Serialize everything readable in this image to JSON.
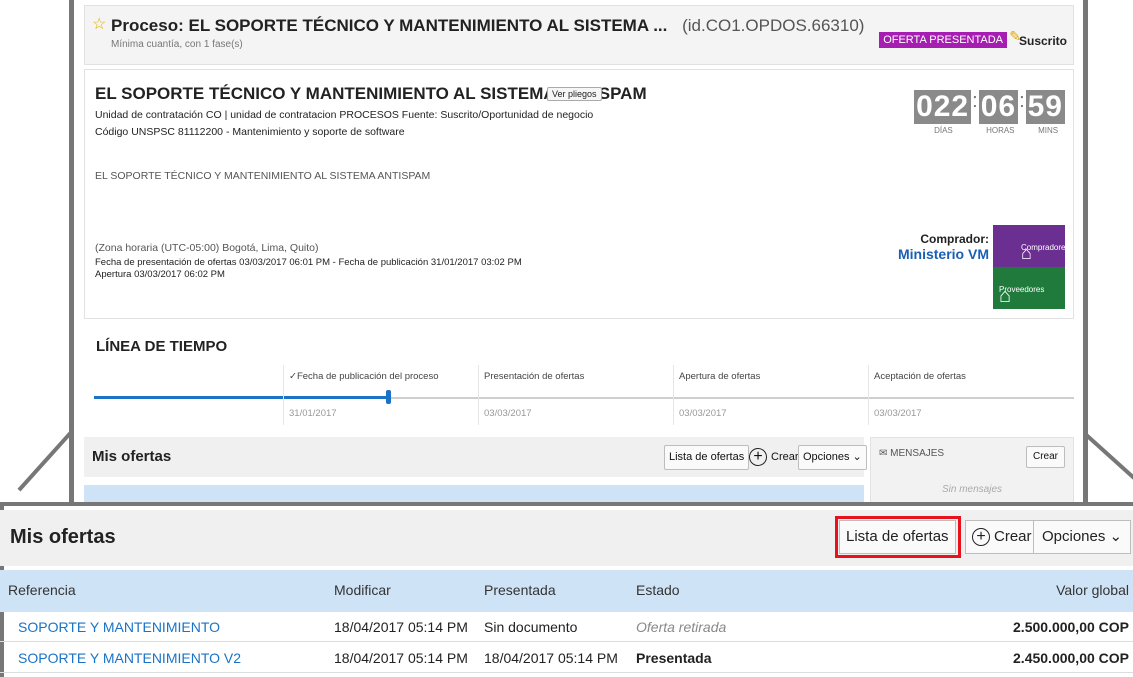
{
  "header": {
    "title_prefix": "Proceso:",
    "title": "EL SOPORTE TÉCNICO Y MANTENIMIENTO AL SISTEMA ...",
    "process_id": "(id.CO1.OPDOS.66310)",
    "subtitle": "Mínima cuantía, con 1 fase(s)",
    "status_badge": "OFERTA PRESENTADA",
    "subscribed": "Suscrito",
    "badge_color": "#a51eb1"
  },
  "details": {
    "heading": "EL SOPORTE TÉCNICO Y MANTENIMIENTO AL SISTEMA ANTISPAM",
    "ver_pliegos": "Ver pliegos",
    "unit_line": "Unidad de contratación CO | unidad de contratacion PROCESOS Fuente: Suscrito/Oportunidad de negocio",
    "unspsc_line": "Código UNSPSC 81112200 - Mantenimiento y soporte de software",
    "description": "EL SOPORTE TÉCNICO Y MANTENIMIENTO AL SISTEMA ANTISPAM",
    "timezone": "(Zona horaria (UTC-05:00) Bogotá, Lima, Quito)",
    "dates_line": "Fecha de presentación de ofertas 03/03/2017 06:01 PM  -  Fecha de publicación 31/01/2017 03:02 PM",
    "apertura_line": "Apertura 03/03/2017 06:02 PM",
    "countdown": {
      "days": "022",
      "hours": "06",
      "mins": "59",
      "days_label": "DÍAS",
      "hours_label": "HORAS",
      "mins_label": "MINS"
    },
    "buyer_label": "Comprador:",
    "buyer_name": "Ministerio VM",
    "logo_top": "Compradores",
    "logo_bottom": "Proveedores"
  },
  "timeline": {
    "title": "LÍNEA DE TIEMPO",
    "progress": 0.3,
    "steps": [
      {
        "label": "✓Fecha de publicación del proceso",
        "date": "31/01/2017"
      },
      {
        "label": "Presentación de ofertas",
        "date": "03/03/2017"
      },
      {
        "label": "Apertura de ofertas",
        "date": "03/03/2017"
      },
      {
        "label": "Aceptación de ofertas",
        "date": "03/03/2017"
      }
    ]
  },
  "mis_ofertas": {
    "title": "Mis ofertas",
    "lista_button": "Lista de ofertas",
    "crear_button": "Crear",
    "opciones_button": "Opciones",
    "columns": [
      "Referencia",
      "Modificar",
      "Presentada",
      "Estado",
      "Valor global"
    ],
    "rows": [
      {
        "ref": "SOPORTE Y MANTENIMIENTO",
        "modificar": "18/04/2017 05:14 PM",
        "presentada": "Sin documento",
        "estado": "Oferta retirada",
        "valor": "2.500.000,00 COP"
      },
      {
        "ref": "SOPORTE Y MANTENIMIENTO V2",
        "modificar": "18/04/2017 05:14 PM",
        "presentada": "18/04/2017 05:14 PM",
        "estado": "Presentada",
        "valor": "2.450.000,00 COP"
      }
    ]
  },
  "mensajes": {
    "title": "MENSAJES",
    "crear_button": "Crear",
    "empty": "Sin mensajes"
  },
  "highlight_color": "#e8121c"
}
